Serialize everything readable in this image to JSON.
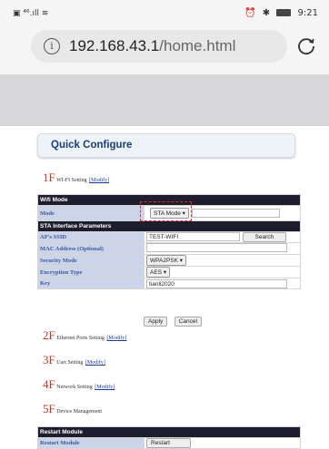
{
  "status_bar": {
    "left": "▣ ⁴⁶.ıll ≋",
    "alarm": "⏰",
    "bluetooth": "✱",
    "time": "9:21"
  },
  "address_bar": {
    "host": "192.168.43.1",
    "path": "/home.html"
  },
  "quick_configure": {
    "title": "Quick Configure"
  },
  "sections": [
    {
      "num": "1F",
      "label": "WI-FI Setting",
      "modify": "[Modify]"
    },
    {
      "num": "2F",
      "label": "Ethernet Ports Setting",
      "modify": "[Modify]"
    },
    {
      "num": "3F",
      "label": "Uart Setting",
      "modify": "[Modify]"
    },
    {
      "num": "4F",
      "label": "Network Setting",
      "modify": "[Modify]"
    },
    {
      "num": "5F",
      "label": "Device Management"
    }
  ],
  "wifi_table": {
    "wifi_mode_header": "Wifi Mode",
    "mode_label": "Mode",
    "mode_value": "STA Mode",
    "sta_header": "STA Interface Parameters",
    "ssid_label": "AP's SSID",
    "ssid_value": "TEST-WIFI",
    "search_button": "Search",
    "mac_label": "MAC Address (Optional)",
    "mac_value": "",
    "security_label": "Security Mode",
    "security_value": "WPA2PSK",
    "encryption_label": "Encryption Type",
    "encryption_value": "AES",
    "key_label": "Key",
    "key_value": "tianli2020"
  },
  "buttons": {
    "apply": "Apply",
    "cancel": "Cancel"
  },
  "restart_table": {
    "header": "Restart Module",
    "label": "Restart Module",
    "button": "Restart"
  },
  "colors": {
    "accent_red": "#c0392b",
    "link_blue": "#1a3a8f",
    "label_bg": "#cbd4e9",
    "header_bg": "#1d1d2d"
  }
}
